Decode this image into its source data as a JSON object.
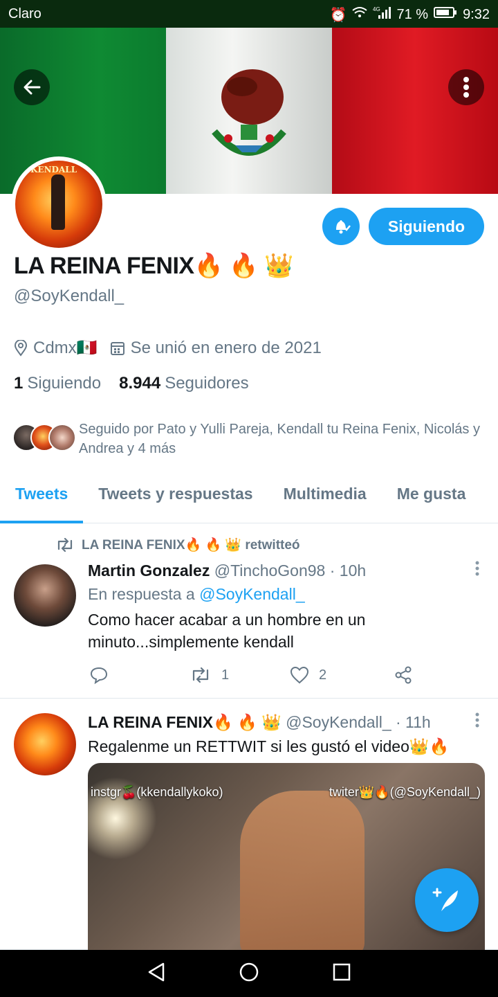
{
  "status_bar": {
    "carrier": "Claro",
    "network": "4G",
    "battery_percent": "71 %",
    "time": "9:32"
  },
  "banner": {
    "description_icons": [
      "back-arrow-icon",
      "more-vertical-icon"
    ]
  },
  "profile": {
    "name": "LA REINA FENIX🔥 🔥 👑",
    "handle": "@SoyKendall_",
    "location": "Cdmx🇲🇽",
    "joined": "Se unió en enero de 2021",
    "following_count": "1",
    "following_label": "Siguiendo",
    "followers_count": "8.944",
    "followers_label": "Seguidores",
    "follow_button": "Siguiendo",
    "followed_by": "Seguido por Pato y Yulli Pareja, Kendall tu Reina Fenix, Nicolás y Andrea y 4 más",
    "avatar_text": "KENDALL"
  },
  "tabs": [
    {
      "label": "Tweets",
      "active": true
    },
    {
      "label": "Tweets y respuestas",
      "active": false
    },
    {
      "label": "Multimedia",
      "active": false
    },
    {
      "label": "Me gusta",
      "active": false
    }
  ],
  "tweets": [
    {
      "retweeted_by": "LA REINA FENIX🔥 🔥 👑 retwitteó",
      "name": "Martin Gonzalez",
      "handle": "@TinchoGon98",
      "time": "· 10h",
      "reply_prefix": "En respuesta a",
      "reply_mention": "@SoyKendall_",
      "text": "Como hacer acabar a un hombre en un minuto...simplemente kendall",
      "reply_count": "",
      "retweet_count": "1",
      "like_count": "2"
    },
    {
      "name": "LA REINA FENIX🔥 🔥 👑",
      "handle": "@SoyKendall_",
      "time": "· 11h",
      "text": "Regalenme un RETTWIT si les gustó el video👑🔥",
      "media_caption_left": "instgr🍒(kkendallykoko)",
      "media_caption_right": "twiter👑🔥(@SoyKendall_)"
    }
  ],
  "colors": {
    "accent": "#1da1f2",
    "muted_text": "#657786",
    "status_bar_bg": "#0a2a0e",
    "nav_bar_bg": "#000000"
  }
}
